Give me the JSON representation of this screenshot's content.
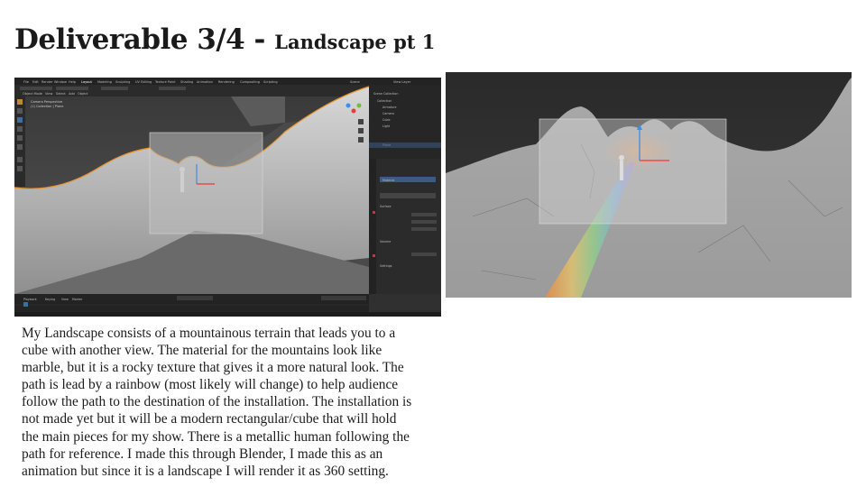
{
  "slide": {
    "title_main": "Deliverable 3/4 - ",
    "title_sub": "Landscape pt 1",
    "body": "My Landscape consists of a mountainous terrain that leads you to a\ncube with another view. The material for the mountains look like\nmarble, but it is a rocky texture that gives it a more natural look. The\npath is lead by a rainbow (most likely will change) to help audience\nfollow the path to the destination of the installation. The installation is\nnot made yet but it will be a modern rectangular/cube that will hold\nthe main pieces for my show. There is a metallic human following the\npath for reference. I made this through Blender, I made this as an\nanimation but since it is a landscape I will render it as 360 setting."
  },
  "blender_screenshot": {
    "menu": [
      "File",
      "Edit",
      "Render",
      "Window",
      "Help",
      "Layout",
      "Modeling",
      "Sculpting",
      "UV Editing",
      "Texture Paint",
      "Shading",
      "Animation",
      "Rendering",
      "Compositing",
      "Scripting"
    ],
    "scene_label": "Scene",
    "view_layer_label": "View Layer",
    "viewport_mode": "Object Mode",
    "view_menus": [
      "View",
      "Select",
      "Add",
      "Object"
    ],
    "viewport_info": [
      "Camera Perspective",
      "(1) Collection | Plane"
    ],
    "outliner_title": "Scene Collection",
    "outliner_items": [
      "Collection",
      "Armature",
      "Camera",
      "Cube",
      "Light",
      "Plane"
    ],
    "properties_tabs": [
      "Surface",
      "Volume",
      "Settings"
    ],
    "material_name": "Material",
    "timeline": [
      "Playback",
      "Keying",
      "View",
      "Marker"
    ]
  },
  "colors": {
    "terrain_edge": "#e8922a",
    "gizmo_axis_z": "#3b8ee8",
    "gizmo_axis_x": "#e83b3b",
    "blender_bg": "#303030"
  }
}
